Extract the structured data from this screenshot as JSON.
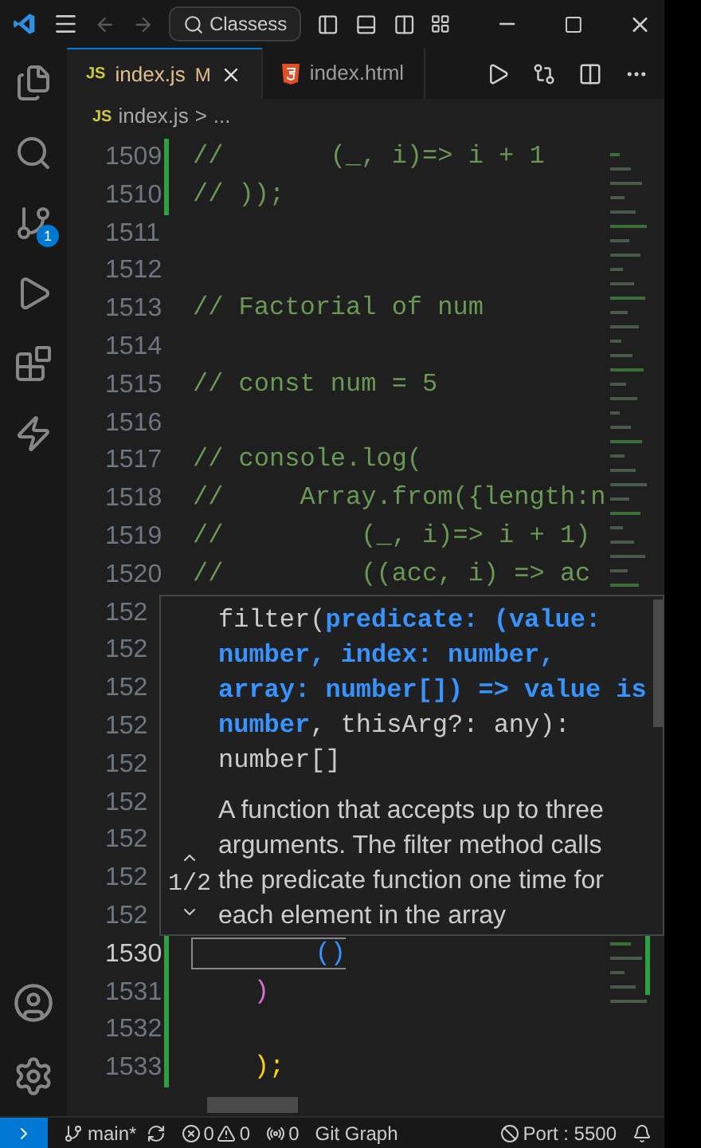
{
  "titlebar": {
    "search": "Classess"
  },
  "activity_bar": {
    "source_control_badge": "1"
  },
  "tabs": [
    {
      "label": "index.js",
      "icon": "JS",
      "badge": "M",
      "kind": "js",
      "selected": true
    },
    {
      "label": "index.html",
      "kind": "html",
      "selected": false
    }
  ],
  "breadcrumb": {
    "icon": "JS",
    "file": "index.js",
    "separator": ">",
    "rest": "..."
  },
  "lines": [
    {
      "number": "1509",
      "code": "//       (_, i)=> i + 1",
      "kind": "comment",
      "changed": true
    },
    {
      "number": "1510",
      "code": "// ));",
      "kind": "comment",
      "changed": true
    },
    {
      "number": "1511",
      "kind": "blank",
      "changed": false
    },
    {
      "number": "1512",
      "kind": "blank",
      "changed": false
    },
    {
      "number": "1513",
      "code": "// Factorial of num",
      "kind": "comment",
      "changed": false
    },
    {
      "number": "1514",
      "kind": "blank",
      "changed": false
    },
    {
      "number": "1515",
      "code": "// const num = 5",
      "kind": "comment",
      "changed": false
    },
    {
      "number": "1516",
      "kind": "blank",
      "changed": false
    },
    {
      "number": "1517",
      "code": "// console.log(",
      "kind": "comment",
      "changed": false
    },
    {
      "number": "1518",
      "code": "//     Array.from({length:n",
      "kind": "comment",
      "changed": false
    },
    {
      "number": "1519",
      "code": "//         (_, i)=> i + 1)",
      "kind": "comment",
      "changed": false
    },
    {
      "number": "1520",
      "code": "//         ((acc, i) => ac",
      "kind": "comment",
      "changed": false
    },
    {
      "number": "152",
      "kind": "blank"
    },
    {
      "number": "152",
      "kind": "blank"
    },
    {
      "number": "152",
      "kind": "blank"
    },
    {
      "number": "152",
      "kind": "blank"
    },
    {
      "number": "152",
      "kind": "blank"
    },
    {
      "number": "152",
      "kind": "blank"
    },
    {
      "number": "152",
      "kind": "blank"
    },
    {
      "number": "152",
      "kind": "blank"
    },
    {
      "number": "152",
      "kind": "blank"
    },
    {
      "number": "1530",
      "code": "        ()",
      "kind": "cursor",
      "color": "#3794ff",
      "changed": true
    },
    {
      "number": "1531",
      "code": "    )",
      "kind": "bracket",
      "color": "#da70d6",
      "changed": true
    },
    {
      "number": "1532",
      "kind": "blank",
      "changed": true
    },
    {
      "number": "1533",
      "code": "    );",
      "kind": "bracket",
      "color": "#ffd700",
      "changed": true
    }
  ],
  "hover": {
    "counter": "1/2",
    "signature": "filter(**predicate: (value: number, index: number, array: number[]) => value is number**, thisArg?: any): number[]",
    "doc": "A function that accepts up to three arguments. The filter method calls the predicate function one time for each element in the array"
  },
  "status_bar": {
    "branch": "main*",
    "errors": "0",
    "warnings": "0",
    "ports": "0",
    "git_graph": "Git Graph",
    "port": "Port : 5500"
  }
}
